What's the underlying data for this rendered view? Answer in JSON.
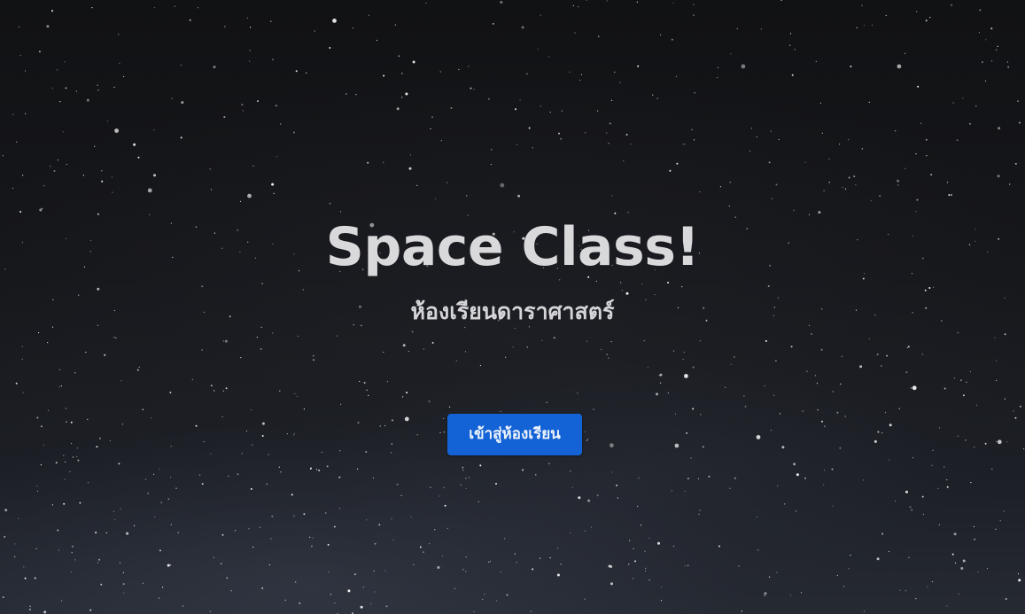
{
  "hero": {
    "title": "Space Class!",
    "subtitle": "ห้องเรียนดาราศาสตร์",
    "enter_button_label": "เข้าสู่ห้องเรียน"
  },
  "colors": {
    "background": "#141518",
    "title_text": "#d9d9db",
    "button_background": "#1463d6",
    "button_text": "#eef3fb"
  }
}
